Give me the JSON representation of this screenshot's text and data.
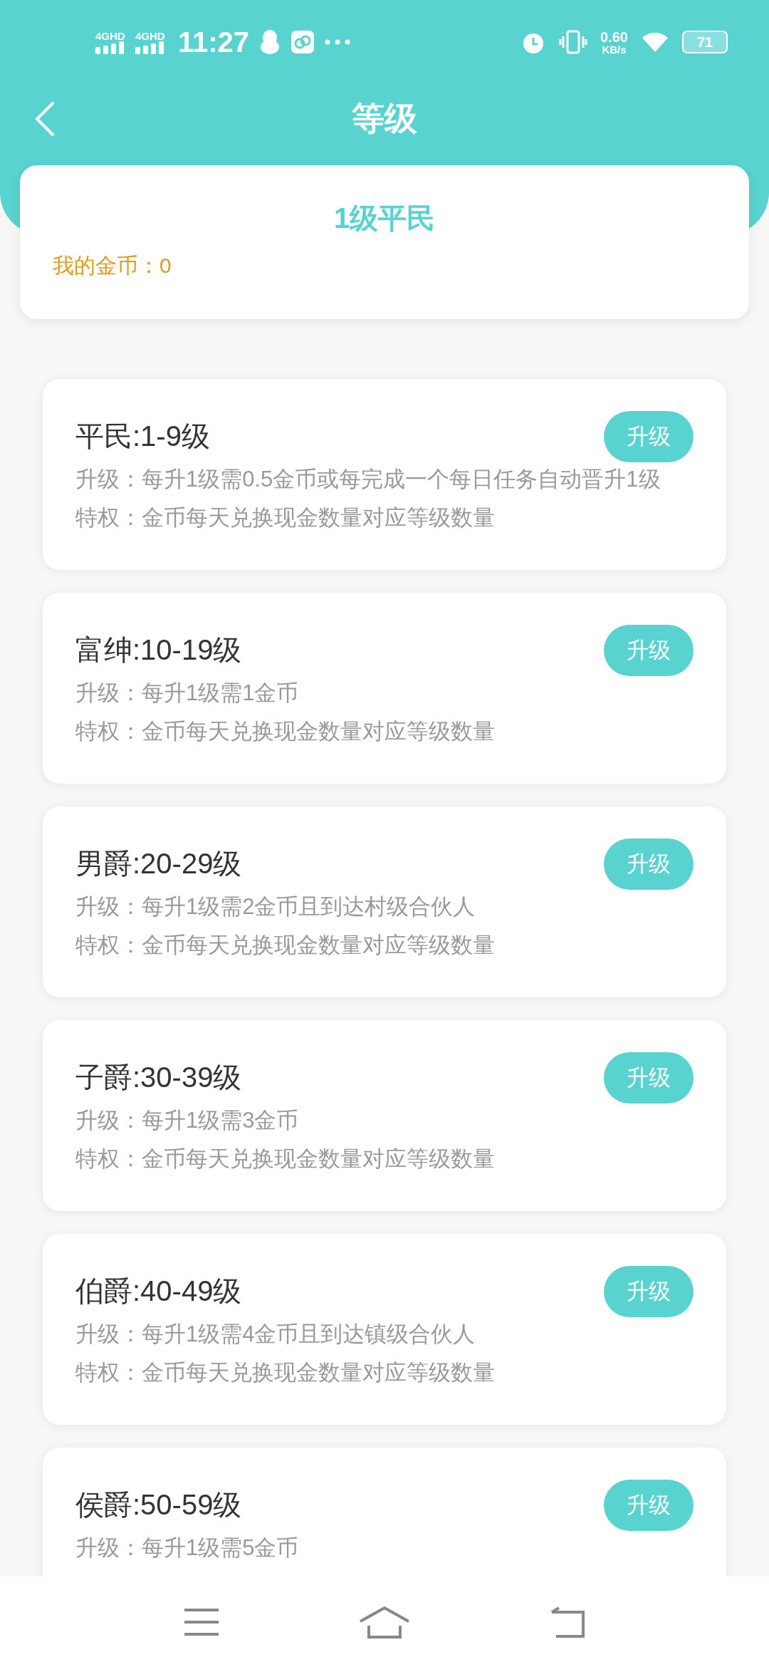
{
  "status_bar": {
    "network_1": "4GHD",
    "network_2": "4GHD",
    "time": "11:27",
    "speed": "0.60",
    "speed_unit": "KB/s",
    "battery": "71"
  },
  "header": {
    "title": "等级"
  },
  "summary": {
    "level": "1级平民",
    "coins_label": "我的金币：",
    "coins": "0"
  },
  "levels": [
    {
      "title": "平民:1-9级",
      "upgrade": "升级：每升1级需0.5金币或每完成一个每日任务自动晋升1级",
      "privilege": "特权：金币每天兑换现金数量对应等级数量",
      "button": "升级"
    },
    {
      "title": "富绅:10-19级",
      "upgrade": "升级：每升1级需1金币",
      "privilege": "特权：金币每天兑换现金数量对应等级数量",
      "button": "升级"
    },
    {
      "title": "男爵:20-29级",
      "upgrade": "升级：每升1级需2金币且到达村级合伙人",
      "privilege": "特权：金币每天兑换现金数量对应等级数量",
      "button": "升级"
    },
    {
      "title": "子爵:30-39级",
      "upgrade": "升级：每升1级需3金币",
      "privilege": "特权：金币每天兑换现金数量对应等级数量",
      "button": "升级"
    },
    {
      "title": "伯爵:40-49级",
      "upgrade": "升级：每升1级需4金币且到达镇级合伙人",
      "privilege": "特权：金币每天兑换现金数量对应等级数量",
      "button": "升级"
    },
    {
      "title": "侯爵:50-59级",
      "upgrade": "升级：每升1级需5金币",
      "button": "升级"
    }
  ]
}
